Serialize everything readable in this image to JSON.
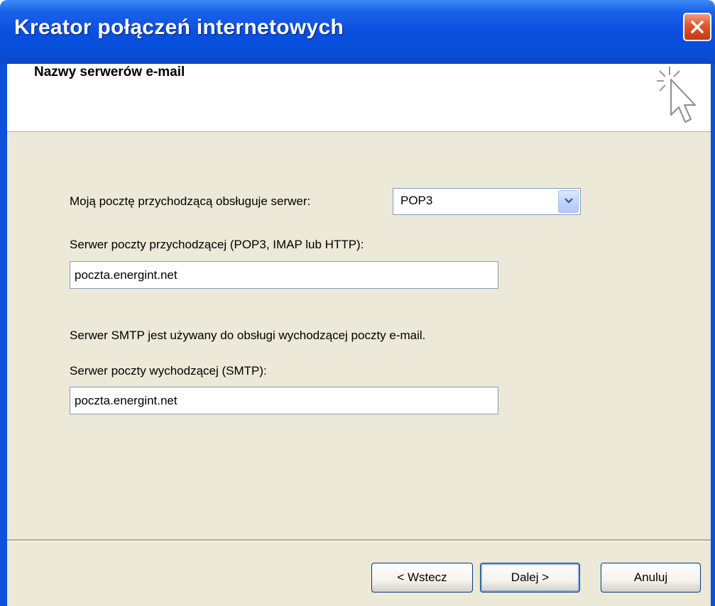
{
  "window": {
    "title": "Kreator połączeń internetowych"
  },
  "header": {
    "page_title": "Nazwy serwerów e-mail"
  },
  "form": {
    "incoming_type_label": "Moją pocztę przychodzącą obsługuje serwer:",
    "incoming_type_value": "POP3",
    "incoming_server_label": "Serwer poczty przychodzącej (POP3, IMAP lub HTTP):",
    "incoming_server_value": "poczta.energint.net",
    "smtp_info": "Serwer SMTP jest używany do obsługi wychodzącej poczty e-mail.",
    "outgoing_server_label": "Serwer poczty wychodzącej (SMTP):",
    "outgoing_server_value": "poczta.energint.net"
  },
  "buttons": {
    "back": "< Wstecz",
    "next": "Dalej >",
    "cancel": "Anuluj"
  },
  "icons": {
    "close": "close-icon",
    "wizard": "wizard-cursor-icon",
    "dropdown": "chevron-down-icon"
  },
  "colors": {
    "titlebar": "#0a4fe0",
    "close_button": "#e2542c",
    "body_background": "#ece9d8"
  }
}
